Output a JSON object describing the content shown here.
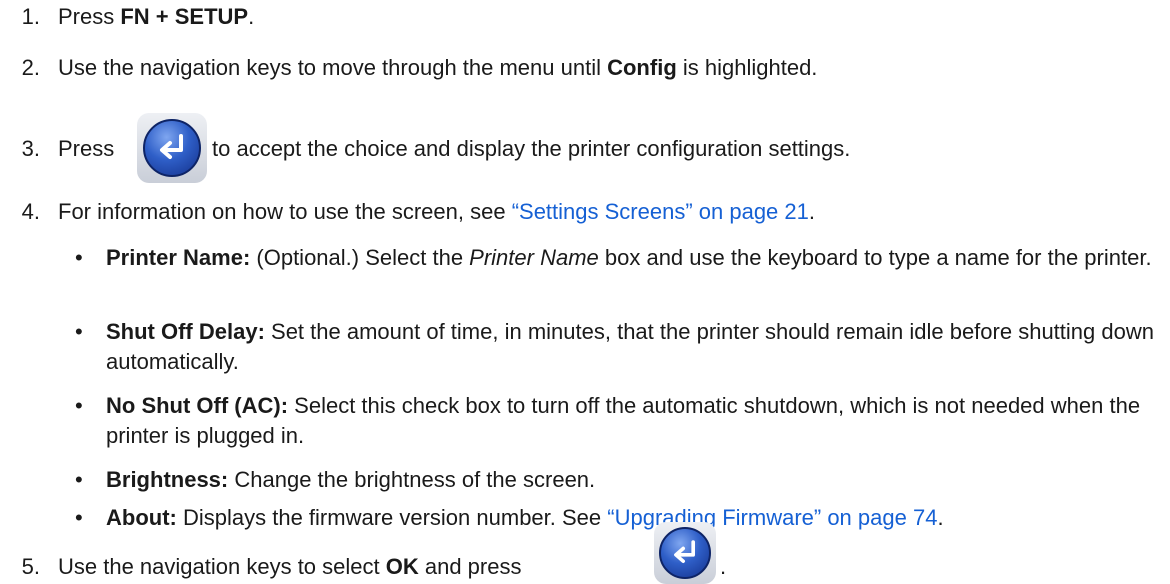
{
  "steps": [
    {
      "num": "1.",
      "pre": "Press ",
      "bold": "FN + SETUP",
      "post": "."
    },
    {
      "num": "2.",
      "pre": "Use the navigation keys to move through the menu until ",
      "bold": "Config",
      "post": " is highlighted."
    },
    {
      "num": "3.",
      "pre": "Press ",
      "post": " to accept the choice and display the printer configuration settings."
    },
    {
      "num": "4.",
      "pre": "For information on how to use the screen, see ",
      "link": "“Settings Screens” on page 21",
      "post": "."
    },
    {
      "num": "5.",
      "pre": "Use the navigation keys to select ",
      "bold": "OK",
      "mid": " and press ",
      "post": "."
    }
  ],
  "settings": [
    {
      "term": "Printer Name:",
      "text1": " (Optional.) Select the ",
      "italic": "Printer Name",
      "text2": " box and use the keyboard to type a name for the printer."
    },
    {
      "term": "Shut Off Delay:",
      "text": " Set the amount of time, in minutes, that the printer should remain idle before shutting down automatically."
    },
    {
      "term": "No Shut Off (AC):",
      "text": " Select this check box to turn off the automatic shutdown, which is not needed when the printer is plugged in."
    },
    {
      "term": "Brightness:",
      "text": " Change the brightness of the screen."
    },
    {
      "term": "About:",
      "text": " Displays the firmware version number. See ",
      "link": "“Upgrading Firmware” on page 74",
      "post": "."
    }
  ],
  "bullet_glyph": "•",
  "icons": {
    "enter_key": "enter-key-icon"
  },
  "colors": {
    "link": "#1560d4",
    "key_blue": "#2f5fc8"
  }
}
